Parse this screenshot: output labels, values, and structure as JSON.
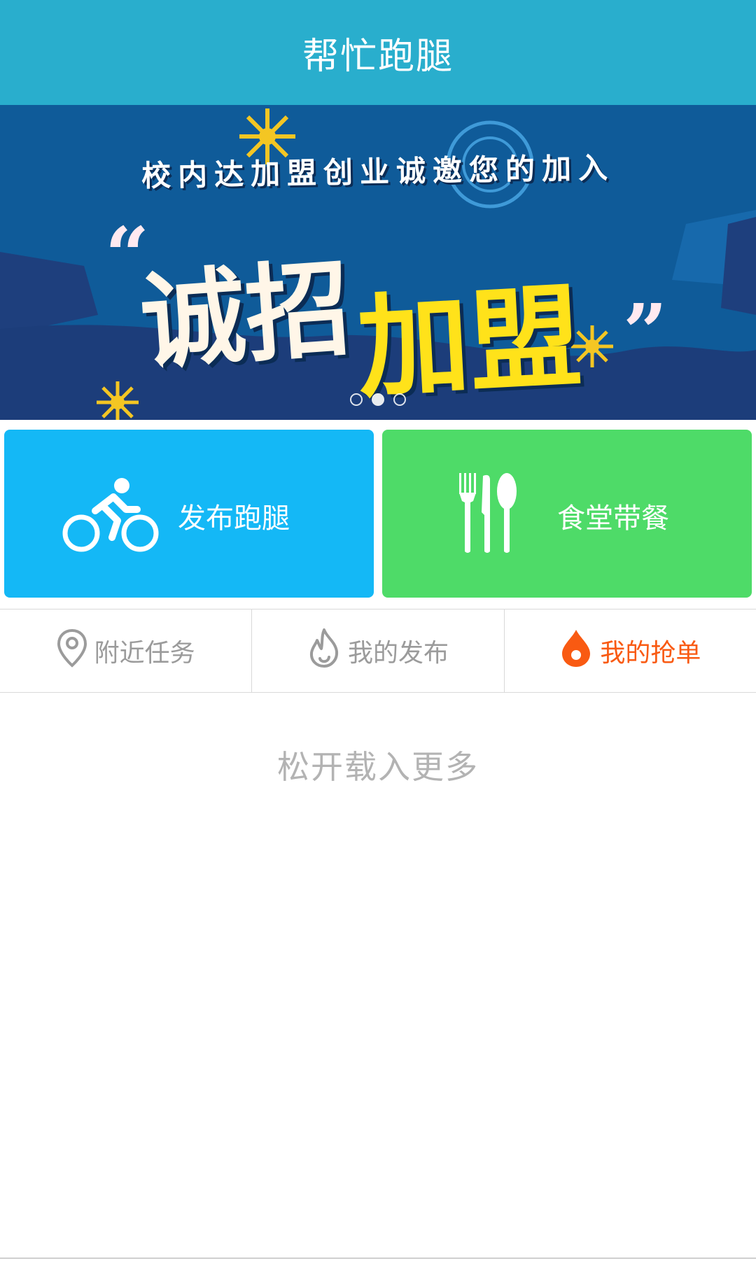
{
  "header": {
    "title": "帮忙跑腿"
  },
  "banner": {
    "headline": "校内达加盟创业诚邀您的加入",
    "open_quote": "“",
    "slogan_part1": "诚招",
    "slogan_part2": "加盟",
    "close_quote": "”",
    "slide_count": 3,
    "active_slide": 2
  },
  "actions": {
    "run": {
      "label": "发布跑腿",
      "icon": "bicycle-icon",
      "color": "#14b8f6"
    },
    "meal": {
      "label": "食堂带餐",
      "icon": "utensils-icon",
      "color": "#4edb68"
    }
  },
  "tabs": [
    {
      "label": "附近任务",
      "icon": "location-pin-icon",
      "active": false
    },
    {
      "label": "我的发布",
      "icon": "flame-outline-icon",
      "active": false
    },
    {
      "label": "我的抢单",
      "icon": "drop-icon",
      "active": true
    }
  ],
  "list": {
    "pull_hint": "松开载入更多"
  },
  "colors": {
    "header": "#29aecd",
    "active_tab": "#f95a12",
    "inactive_tab": "#9b9b9b"
  }
}
